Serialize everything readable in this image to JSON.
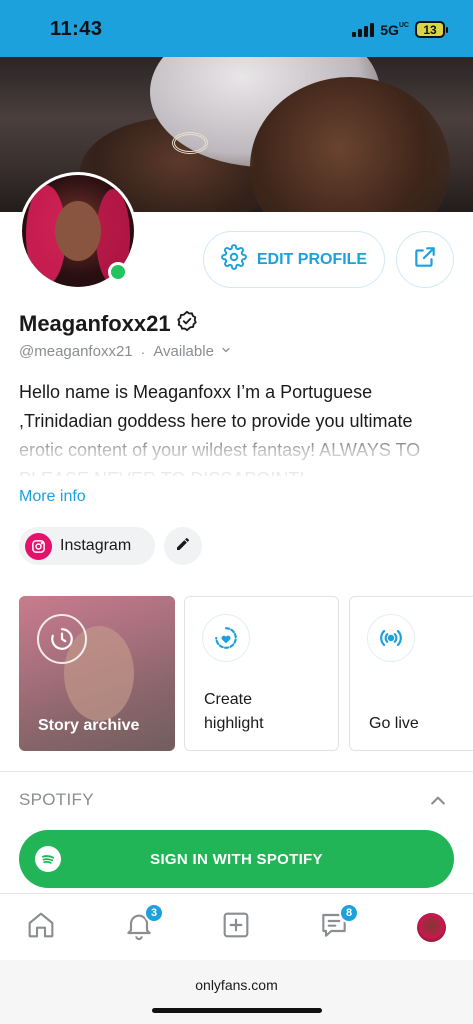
{
  "status_bar": {
    "time": "11:43",
    "network": "5G",
    "network_sup": "UC",
    "battery": "13"
  },
  "profile": {
    "display_name": "Meaganfoxx21",
    "handle": "@meaganfoxx21",
    "separator": "·",
    "availability": "Available",
    "bio": "Hello name is Meaganfoxx I’m a Portuguese ,Trinidadian goddess here to provide you ultimate erotic content of your wildest fantasy! ALWAYS TO PLEASE NEVER TO DISSAPOINT!",
    "more_info": "More info",
    "edit_profile": "EDIT PROFILE",
    "online_color": "#21c45d"
  },
  "socials": {
    "instagram_label": "Instagram"
  },
  "cards": {
    "story_archive": "Story archive",
    "create_highlight_line1": "Create",
    "create_highlight_line2": "highlight",
    "go_live": "Go live"
  },
  "spotify": {
    "section_title": "SPOTIFY",
    "signin": "SIGN IN WITH SPOTIFY",
    "color": "#21b558"
  },
  "bottom_nav": {
    "notifications_badge": "3",
    "messages_badge": "8"
  },
  "browser": {
    "url": "onlyfans.com"
  },
  "colors": {
    "accent": "#1da1dc",
    "instagram": "#e4126b"
  },
  "icons": [
    "gear-icon",
    "share-icon",
    "verified-icon",
    "chevron-down-icon",
    "instagram-icon",
    "pencil-icon",
    "clock-icon",
    "heart-icon",
    "live-icon",
    "chevron-up-icon",
    "spotify-icon",
    "home-icon",
    "bell-icon",
    "plus-square-icon",
    "messages-icon"
  ]
}
